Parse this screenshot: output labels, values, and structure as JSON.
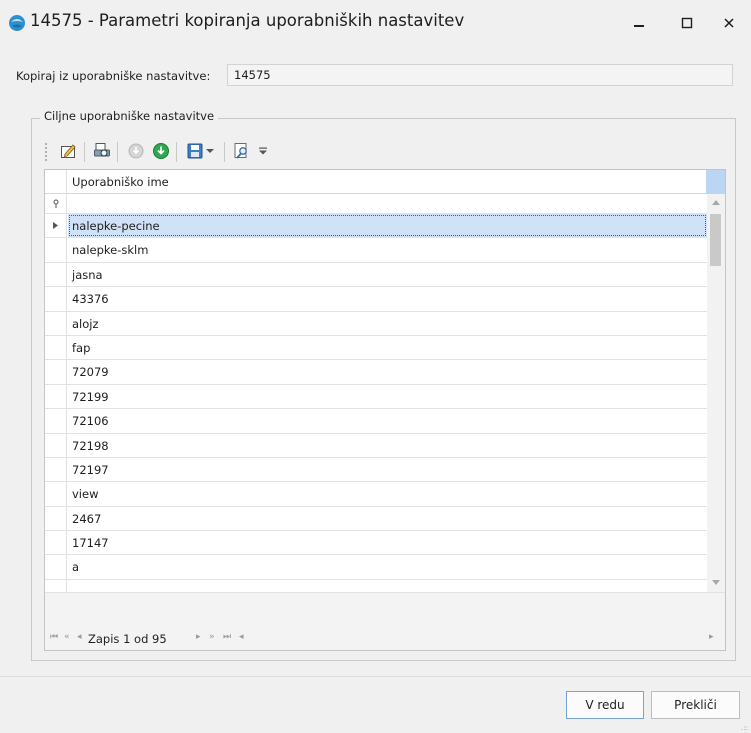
{
  "window": {
    "title": "14575 - Parametri kopiranja uporabniških nastavitev",
    "min_symbol": "–",
    "max_symbol": "□",
    "close_symbol": "✕"
  },
  "copy_from": {
    "label": "Kopiraj iz uporabniške nastavitve:",
    "value": "14575"
  },
  "group": {
    "title": "Ciljne uporabniške nastavitve"
  },
  "toolbar": {
    "icons": [
      "edit-icon",
      "print-preview-icon",
      "disabled-circle-icon",
      "download-icon",
      "save-icon",
      "save-dropdown-icon",
      "find-icon",
      "toolbar-overflow-icon"
    ]
  },
  "grid": {
    "column_header": "Uporabniško ime",
    "selected_index": 0,
    "rows": [
      "nalepke-pecine",
      "nalepke-sklm",
      "jasna",
      "43376",
      "alojz",
      "fap",
      "72079",
      "72199",
      "72106",
      "72198",
      "72197",
      "view",
      "2467",
      "17147",
      "a",
      ""
    ],
    "navigator": {
      "record_text": "Zapis 1 od 95",
      "first": "⏮",
      "prev_page": "«",
      "prev": "◂",
      "next": "▸",
      "next_page": "»",
      "last": "⏭",
      "scroll_left": "◂",
      "scroll_right": "▸"
    }
  },
  "buttons": {
    "ok": "V redu",
    "cancel": "Prekliči"
  },
  "colors": {
    "selection": "#cfe2f7",
    "accent": "#2e8fcf"
  }
}
